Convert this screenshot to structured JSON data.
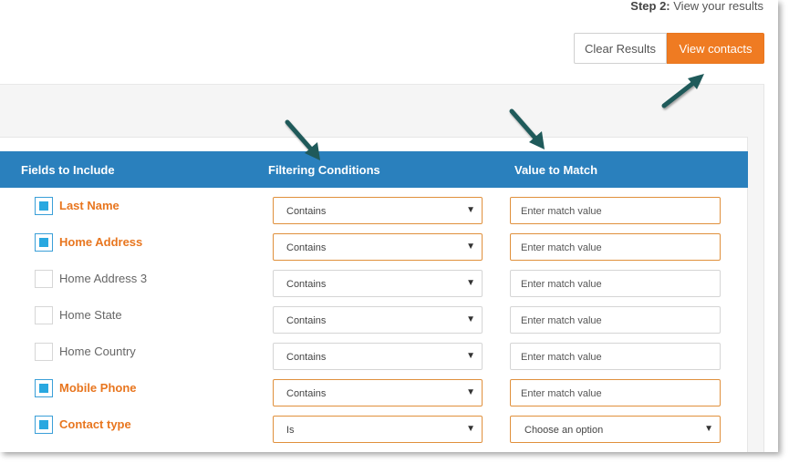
{
  "step": {
    "prefix": "Step 2:",
    "text": "View your results"
  },
  "buttons": {
    "clear": "Clear Results",
    "view": "View contacts"
  },
  "table": {
    "headers": [
      "Fields to Include",
      "Filtering Conditions",
      "Value to Match"
    ],
    "rows": [
      {
        "field": "Last Name",
        "checked": true,
        "condition": "Contains",
        "value_placeholder": "Enter match value"
      },
      {
        "field": "Home Address",
        "checked": true,
        "condition": "Contains",
        "value_placeholder": "Enter match value"
      },
      {
        "field": "Home Address 3",
        "checked": false,
        "condition": "Contains",
        "value_placeholder": "Enter match value"
      },
      {
        "field": "Home State",
        "checked": false,
        "condition": "Contains",
        "value_placeholder": "Enter match value"
      },
      {
        "field": "Home Country",
        "checked": false,
        "condition": "Contains",
        "value_placeholder": "Enter match value"
      },
      {
        "field": "Mobile Phone",
        "checked": true,
        "condition": "Contains",
        "value_placeholder": "Enter match value"
      },
      {
        "field": "Contact type",
        "checked": true,
        "condition": "Is",
        "value_select": "Choose an option"
      }
    ]
  },
  "icons": {
    "dropdown": "chevron-down-icon",
    "pointer": "arrow-pointer-icon"
  },
  "colors": {
    "accent": "#ef7b22",
    "header": "#2a80bd",
    "checkbox": "#29a8e0",
    "arrow": "#1f5a5a"
  }
}
